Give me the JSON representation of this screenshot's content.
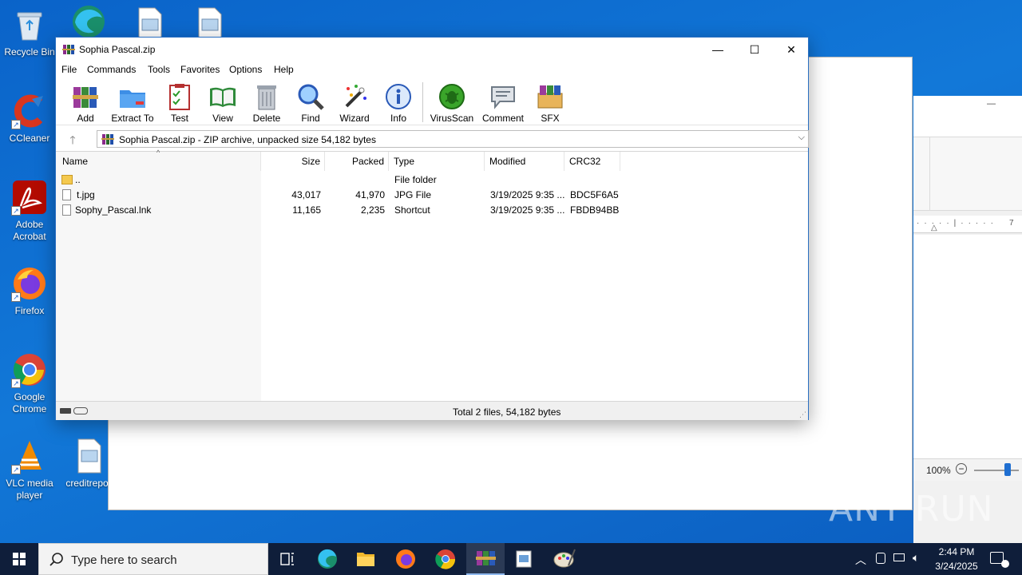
{
  "desktop": {
    "icons": [
      {
        "label": "Recycle Bin"
      },
      {
        "label": "CCleaner"
      },
      {
        "label": "Adobe Acrobat"
      },
      {
        "label": "Firefox"
      },
      {
        "label": "Google Chrome"
      },
      {
        "label": "VLC media player"
      },
      {
        "label": "creditrepor"
      }
    ]
  },
  "background_window": {
    "zoom": "100%",
    "ruler_mark": "7",
    "minimize_glyph": "—"
  },
  "rar": {
    "title": "Sophia Pascal.zip",
    "controls": {
      "minimize": "—",
      "maximize": "☐",
      "close": "✕"
    },
    "menu": [
      "File",
      "Commands",
      "Tools",
      "Favorites",
      "Options",
      "Help"
    ],
    "toolbar": [
      "Add",
      "Extract To",
      "Test",
      "View",
      "Delete",
      "Find",
      "Wizard",
      "Info",
      "VirusScan",
      "Comment",
      "SFX"
    ],
    "path": "Sophia Pascal.zip - ZIP archive, unpacked size 54,182 bytes",
    "columns": {
      "name": "Name",
      "size": "Size",
      "packed": "Packed",
      "type": "Type",
      "modified": "Modified",
      "crc": "CRC32"
    },
    "files": [
      {
        "name": "..",
        "size": "",
        "packed": "",
        "type": "File folder",
        "modified": "",
        "crc": ""
      },
      {
        "name": "t.jpg",
        "size": "43,017",
        "packed": "41,970",
        "type": "JPG File",
        "modified": "3/19/2025 9:35 ...",
        "crc": "BDC5F6A5"
      },
      {
        "name": "Sophy_Pascal.lnk",
        "size": "11,165",
        "packed": "2,235",
        "type": "Shortcut",
        "modified": "3/19/2025 9:35 ...",
        "crc": "FBDB94BB"
      }
    ],
    "status": "Total 2 files, 54,182 bytes"
  },
  "taskbar": {
    "search_placeholder": "Type here to search",
    "time": "2:44 PM",
    "date": "3/24/2025"
  },
  "watermark": "ANY RUN",
  "colors": {
    "accent": "#0a63c9",
    "taskbar": "#0f1e3a",
    "window_border": "#2a6fc2"
  }
}
